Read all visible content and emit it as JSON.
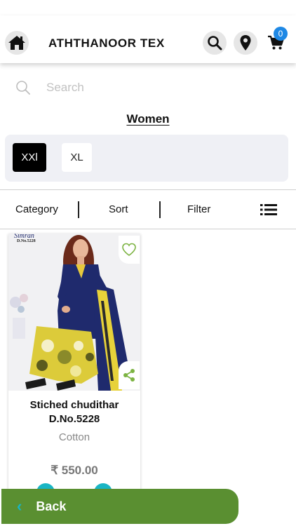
{
  "header": {
    "title": "ATHTHANOOR TEX",
    "home_icon": "home-icon",
    "search_icon": "search-icon",
    "location_icon": "location-pin-icon",
    "cart_icon": "cart-icon",
    "cart_count": "0",
    "cart_badge_color": "#1e88e5"
  },
  "search": {
    "placeholder": "Search",
    "value": ""
  },
  "section": {
    "title": "Women"
  },
  "sizes": [
    {
      "label": "XXl",
      "selected": true
    },
    {
      "label": "XL",
      "selected": false
    }
  ],
  "sortbar": {
    "category": "Category",
    "sort": "Sort",
    "filter": "Filter",
    "view_icon": "list-view-icon"
  },
  "products": [
    {
      "image_caption_brand": "Simran",
      "image_caption_design": "D.No.5228",
      "name": "Stiched chudithar D.No.5228",
      "material": "Cotton",
      "price": "₹ 550.00",
      "wishlist_icon": "heart-outline-icon",
      "share_icon": "share-icon"
    }
  ],
  "footer": {
    "back_label": "Back",
    "back_color": "#5a8f31",
    "accent_color": "#19b5c4"
  }
}
